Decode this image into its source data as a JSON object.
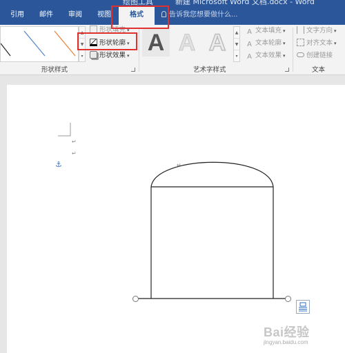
{
  "title": {
    "tool_context": "绘图工具",
    "document": "新建 Microsoft Word 文档.docx - Word"
  },
  "tabs": [
    {
      "label": "引用"
    },
    {
      "label": "邮件"
    },
    {
      "label": "审阅"
    },
    {
      "label": "视图"
    },
    {
      "label": "格式",
      "active": true
    }
  ],
  "tell_me": "告诉我您想要做什么...",
  "ribbon": {
    "shape_styles": {
      "fill_label": "形状填充",
      "outline_label": "形状轮廓",
      "effects_label": "形状效果",
      "group_label": "形状样式"
    },
    "wordart": {
      "sample_letter": "A",
      "text_fill": "文本填充",
      "text_outline": "文本轮廓",
      "text_effects": "文本效果",
      "group_label": "艺术字样式"
    },
    "text": {
      "direction": "文字方向",
      "align": "对齐文本",
      "link": "创建链接",
      "group_label": "文本"
    }
  },
  "document": {
    "paragraph_mark": "↵",
    "anchor_icon": "anchor-icon"
  },
  "watermark": {
    "brand": "Bai经验",
    "url": "jingyan.baidu.com"
  },
  "colors": {
    "accent": "#2b579a",
    "highlight": "#e03030"
  }
}
